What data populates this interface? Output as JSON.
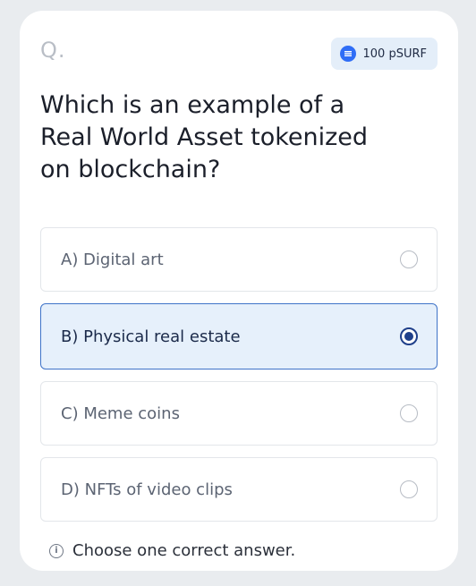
{
  "question_label": "Q.",
  "reward": {
    "amount_text": "100 pSURF",
    "icon": "coin-icon"
  },
  "question_text": "Which is an example of a Real World Asset tokenized on blockchain?",
  "options": [
    {
      "label": "A) Digital art",
      "selected": false
    },
    {
      "label": "B) Physical real estate",
      "selected": true
    },
    {
      "label": "C) Meme coins",
      "selected": false
    },
    {
      "label": "D) NFTs of video clips",
      "selected": false
    }
  ],
  "hint": {
    "text": "Choose one correct answer.",
    "icon": "info-icon"
  },
  "colors": {
    "accent": "#1f3f8a",
    "selected_bg": "#e6f0fb",
    "selected_border": "#3f73c8",
    "badge_bg": "#e4eef9",
    "coin": "#2f6df6"
  }
}
